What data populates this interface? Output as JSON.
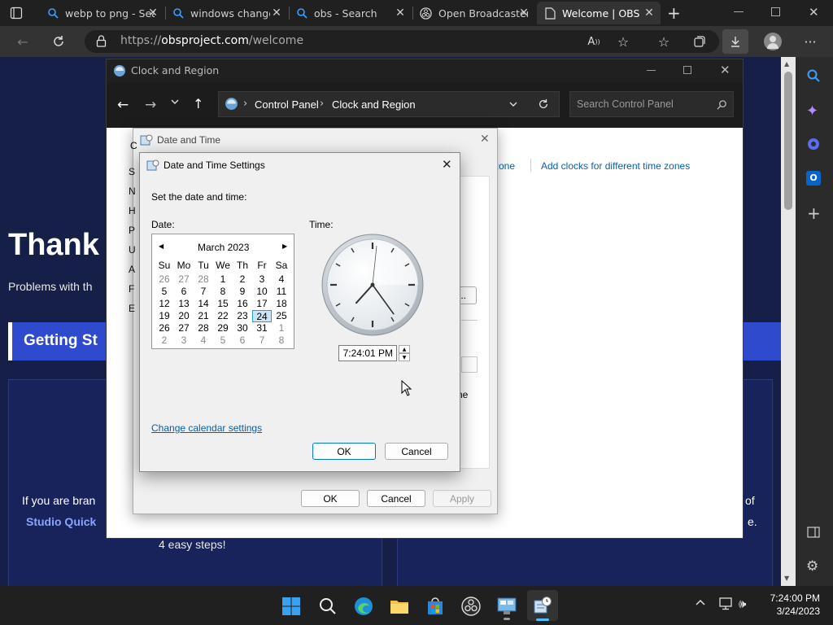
{
  "browser": {
    "tabs": [
      {
        "title": "webp to png - Search"
      },
      {
        "title": "windows change date"
      },
      {
        "title": "obs - Search"
      },
      {
        "title": "Open Broadcaster Software"
      },
      {
        "title": "Welcome | OBS"
      }
    ],
    "url": {
      "scheme": "https://",
      "host": "obsproject.com",
      "path": "/welcome"
    }
  },
  "webpage": {
    "heading": "Thank",
    "subtext": "Problems with th",
    "banner": "Getting St",
    "card_left_text": "If you are bran",
    "card_left_link": "Studio Quick",
    "card_bottom": "4 easy steps!",
    "card_right_text": "of",
    "card_right_text2": "e."
  },
  "control_panel": {
    "title": "Clock and Region",
    "breadcrumb": [
      "Control Panel",
      "Clock and Region"
    ],
    "search_placeholder": "Search Control Panel",
    "links": [
      "e zone",
      "Add clocks for different time zones"
    ],
    "side_letters": [
      "C",
      "S",
      "N",
      "H",
      "P",
      "U",
      "A",
      "F",
      "E"
    ],
    "btn_dots": "...",
    "frag_ne": "ne"
  },
  "date_time_window": {
    "title": "Date and Time",
    "ok": "OK",
    "cancel": "Cancel",
    "apply": "Apply"
  },
  "settings_dialog": {
    "title": "Date and Time Settings",
    "instruction": "Set the date and time:",
    "date_label": "Date:",
    "time_label": "Time:",
    "month": "March 2023",
    "weekdays": [
      "Su",
      "Mo",
      "Tu",
      "We",
      "Th",
      "Fr",
      "Sa"
    ],
    "weeks": [
      [
        "26",
        "27",
        "28",
        "1",
        "2",
        "3",
        "4"
      ],
      [
        "5",
        "6",
        "7",
        "8",
        "9",
        "10",
        "11"
      ],
      [
        "12",
        "13",
        "14",
        "15",
        "16",
        "17",
        "18"
      ],
      [
        "19",
        "20",
        "21",
        "22",
        "23",
        "24",
        "25"
      ],
      [
        "26",
        "27",
        "28",
        "29",
        "30",
        "31",
        "1"
      ],
      [
        "2",
        "3",
        "4",
        "5",
        "6",
        "7",
        "8"
      ]
    ],
    "selected_day": "24",
    "time_value": "7:24:01 PM",
    "clock": {
      "hour": 7,
      "minute": 24,
      "second": 1
    },
    "change_calendar": "Change calendar settings",
    "ok": "OK",
    "cancel": "Cancel"
  },
  "taskbar": {
    "time": "7:24:00 PM",
    "date": "3/24/2023"
  }
}
